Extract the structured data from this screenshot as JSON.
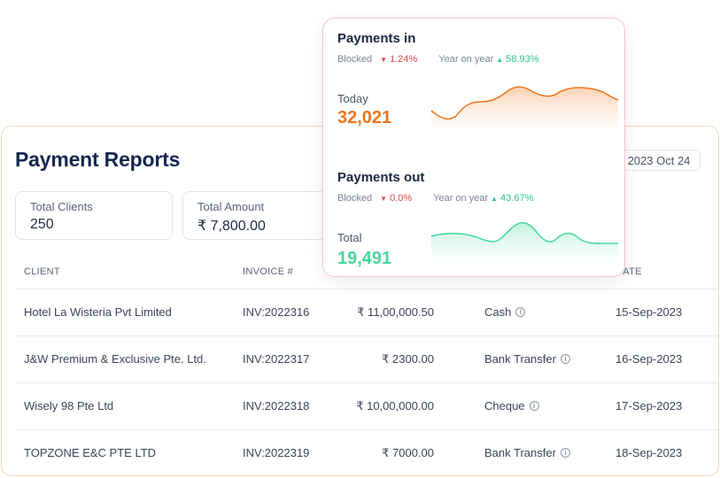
{
  "report": {
    "title": "Payment Reports",
    "date": "2023 Oct 24",
    "stats": [
      {
        "label": "Total Clients",
        "value": "250"
      },
      {
        "label": "Total Amount",
        "value": "₹ 7,800.00"
      }
    ],
    "columns": [
      "CLIENT",
      "INVOICE #",
      "DATE"
    ],
    "rows": [
      {
        "client": "Hotel La Wisteria Pvt Limited",
        "invoice": "INV:2022316",
        "amount": "₹ 11,00,000.50",
        "mode": "Cash",
        "date": "15-Sep-2023"
      },
      {
        "client": "J&W Premium & Exclusive Pte. Ltd.",
        "invoice": "INV:2022317",
        "amount": "₹ 2300.00",
        "mode": "Bank Transfer",
        "date": "16-Sep-2023"
      },
      {
        "client": "Wisely 98 Pte Ltd",
        "invoice": "INV:2022318",
        "amount": "₹ 10,00,000.00",
        "mode": "Cheque",
        "date": "17-Sep-2023"
      },
      {
        "client": "TOPZONE E&C PTE LTD",
        "invoice": "INV:2022319",
        "amount": "₹ 7000.00",
        "mode": "Bank Transfer",
        "date": "18-Sep-2023"
      }
    ]
  },
  "payments_in": {
    "title": "Payments in",
    "blocked_label": "Blocked",
    "blocked_value": "1.24%",
    "yoy_label": "Year on year",
    "yoy_value": "58.93%",
    "sub_label": "Today",
    "amount": "32,021",
    "color": "#e8761e"
  },
  "payments_out": {
    "title": "Payments out",
    "blocked_label": "Blocked",
    "blocked_value": "0.0%",
    "yoy_label": "Year on year",
    "yoy_value": "43.67%",
    "sub_label": "Total",
    "amount": "19,491",
    "color": "#46d69d"
  },
  "icons": {
    "info": "info-icon",
    "down": "triangle-down-icon",
    "up": "triangle-up-icon"
  }
}
